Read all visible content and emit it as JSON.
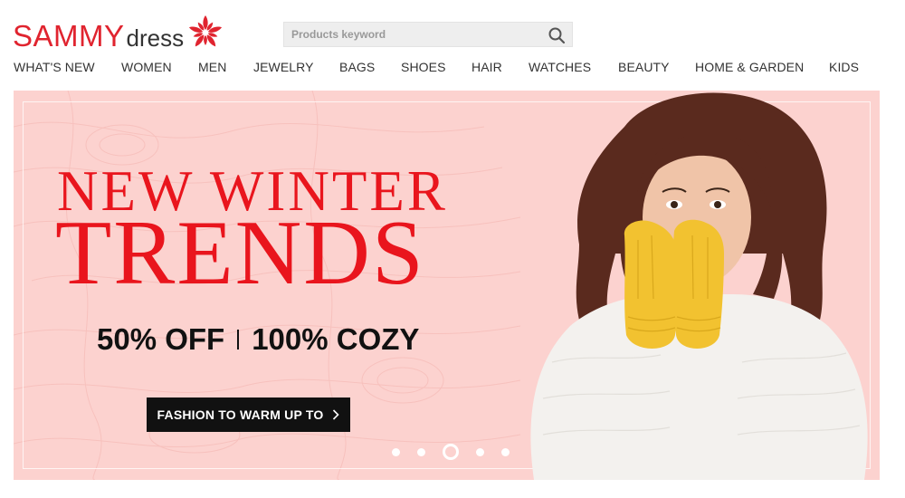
{
  "header": {
    "logo": {
      "word1": "SAMMY",
      "word2": "dress",
      "flower_color": "#e0242f"
    },
    "search": {
      "placeholder": "Products keyword",
      "value": ""
    }
  },
  "nav": {
    "items": [
      "WHAT'S NEW",
      "WOMEN",
      "MEN",
      "JEWELRY",
      "BAGS",
      "SHOES",
      "HAIR",
      "WATCHES",
      "BEAUTY",
      "HOME & GARDEN",
      "KIDS"
    ]
  },
  "banner": {
    "headline_line1": "NEW WINTER",
    "headline_line2": "TRENDS",
    "offer_left": "50% OFF",
    "offer_right": "100% COZY",
    "cta_label": "FASHION TO WARM UP TO",
    "carousel": {
      "slide_count": 5,
      "active_index": 2
    },
    "colors": {
      "background": "#fcd2cf",
      "headline": "#e9151d",
      "cta_bg": "#111111"
    }
  }
}
